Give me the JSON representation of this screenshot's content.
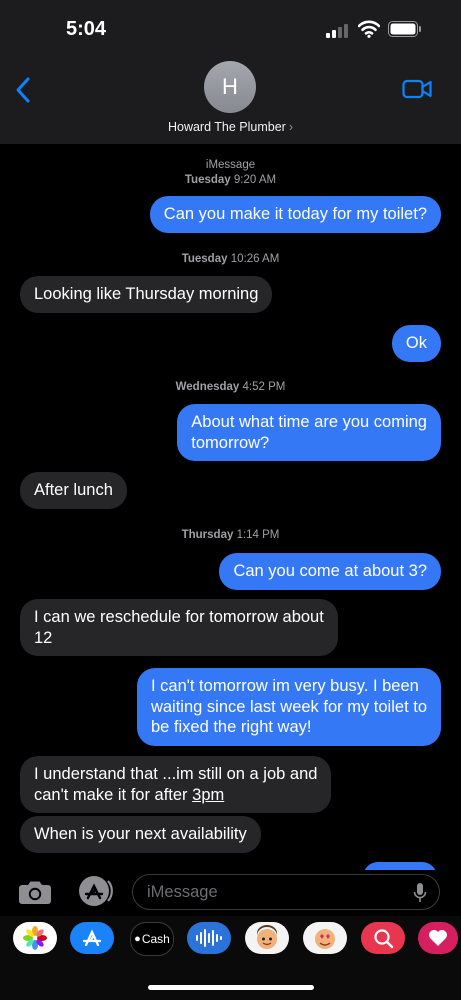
{
  "status": {
    "time": "5:04"
  },
  "header": {
    "avatar_initial": "H",
    "contact_name": "Howard The Plumber",
    "chevron": "›"
  },
  "thread": {
    "service": "iMessage",
    "timestamps": [
      {
        "day": "Tuesday",
        "time": "9:20 AM"
      },
      {
        "day": "Tuesday",
        "time": "10:26 AM"
      },
      {
        "day": "Wednesday",
        "time": "4:52 PM"
      },
      {
        "day": "Thursday",
        "time": "1:14 PM"
      }
    ],
    "messages": [
      {
        "from": "me",
        "lines": [
          "Can you make it today for my toilet?"
        ]
      },
      {
        "from": "them",
        "lines": [
          "Looking like Thursday morning"
        ]
      },
      {
        "from": "me",
        "lines": [
          "Ok"
        ]
      },
      {
        "from": "me",
        "lines": [
          "About what time are you coming",
          "tomorrow?"
        ]
      },
      {
        "from": "them",
        "lines": [
          "After lunch"
        ]
      },
      {
        "from": "me",
        "lines": [
          "Can you come at about 3?"
        ]
      },
      {
        "from": "them",
        "lines": [
          "I can we reschedule for tomorrow about",
          "12"
        ]
      },
      {
        "from": "me",
        "lines": [
          "I can't tomorrow im very busy. I been",
          "waiting since last week for my toilet to",
          "be fixed the right way!"
        ]
      },
      {
        "from": "them",
        "lines": [
          "I understand that ...im still on a job and",
          "can't make it for after "
        ],
        "link": "3pm"
      },
      {
        "from": "them",
        "lines": [
          "When is your next availability"
        ]
      }
    ]
  },
  "input": {
    "placeholder": "iMessage"
  },
  "apps": [
    {
      "name": "photos-app",
      "label": ""
    },
    {
      "name": "app-store-app",
      "label": ""
    },
    {
      "name": "apple-cash-app",
      "label": "Cash"
    },
    {
      "name": "audio-message-app",
      "label": ""
    },
    {
      "name": "memoji-app",
      "label": ""
    },
    {
      "name": "memoji-stickers-app",
      "label": ""
    },
    {
      "name": "search-images-app",
      "label": ""
    },
    {
      "name": "digital-touch-app",
      "label": ""
    }
  ],
  "colors": {
    "sent": "#3478f6",
    "received": "#262628",
    "accent": "#0a84ff",
    "background": "#000000"
  }
}
